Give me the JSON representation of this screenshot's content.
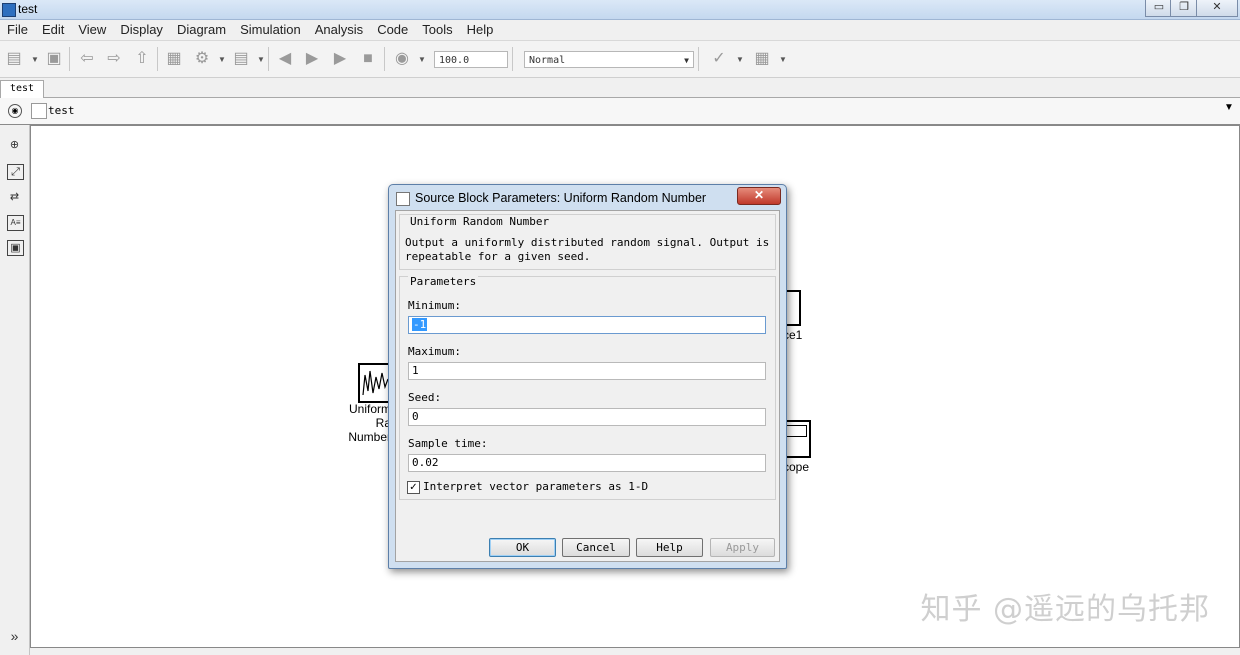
{
  "window": {
    "title": "test",
    "minimize": "▭",
    "restore": "❐",
    "close": "✕"
  },
  "menu": [
    "File",
    "Edit",
    "View",
    "Display",
    "Diagram",
    "Simulation",
    "Analysis",
    "Code",
    "Tools",
    "Help"
  ],
  "toolbar": {
    "stop_time": "100.0",
    "sim_mode": "Normal"
  },
  "tab": {
    "label": "test"
  },
  "breadcrumb": {
    "label": "test"
  },
  "canvas": {
    "uniform_block_label": "Uniform Ra\nNumber",
    "scope1_label": "ce1",
    "scope_label": "cope"
  },
  "dialog": {
    "title": "Source Block Parameters: Uniform Random Number",
    "close": "✕",
    "block_name": "Uniform Random Number",
    "description_line1": "Output a uniformly distributed random signal.  Output is",
    "description_line2": "repeatable for a given seed.",
    "params_header": "Parameters",
    "minimum_label": "Minimum:",
    "minimum_value": "-1",
    "maximum_label": "Maximum:",
    "maximum_value": "1",
    "seed_label": "Seed:",
    "seed_value": "0",
    "sample_time_label": "Sample time:",
    "sample_time_value": "0.02",
    "interpret_label": "Interpret vector parameters as 1-D",
    "interpret_checked": true,
    "ok": "OK",
    "cancel": "Cancel",
    "help": "Help",
    "apply": "Apply"
  },
  "watermark": "知乎 @遥远的乌托邦"
}
